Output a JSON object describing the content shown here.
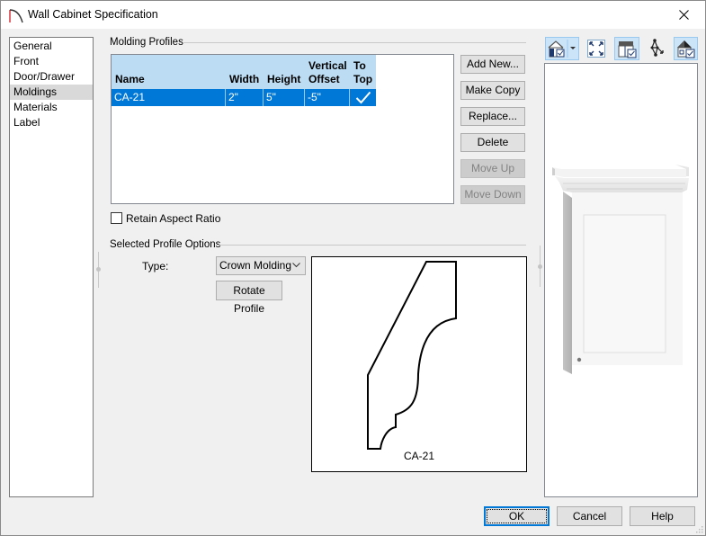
{
  "window": {
    "title": "Wall Cabinet Specification",
    "close_icon": "close-icon"
  },
  "nav": {
    "items": [
      {
        "label": "General",
        "selected": false
      },
      {
        "label": "Front",
        "selected": false
      },
      {
        "label": "Door/Drawer",
        "selected": false
      },
      {
        "label": "Moldings",
        "selected": true
      },
      {
        "label": "Materials",
        "selected": false
      },
      {
        "label": "Label",
        "selected": false
      }
    ]
  },
  "molding_profiles": {
    "group_label": "Molding Profiles",
    "columns": {
      "name": "Name",
      "width": "Width",
      "height": "Height",
      "vertical_offset_line1": "Vertical",
      "vertical_offset_line2": "Offset",
      "to_top_line1": "To",
      "to_top_line2": "Top"
    },
    "rows": [
      {
        "name": "CA-21",
        "width": "2\"",
        "height": "5\"",
        "vertical_offset": "-5\"",
        "to_top": true
      }
    ],
    "selected_row": 0
  },
  "buttons": {
    "add_new": "Add New...",
    "make_copy": "Make Copy",
    "replace": "Replace...",
    "delete": "Delete",
    "move_up": "Move Up",
    "move_down": "Move Down"
  },
  "retain_aspect_ratio": {
    "label": "Retain Aspect Ratio",
    "checked": false
  },
  "selected_profile_options": {
    "group_label": "Selected Profile Options",
    "type_label": "Type:",
    "type_value": "Crown Molding",
    "rotate_button": "Rotate Profile",
    "preview_label": "CA-21"
  },
  "view_toolbar": {
    "tools": [
      {
        "icon": "camera-view-icon",
        "active": true,
        "has_dropdown": true
      },
      {
        "icon": "fill-window-icon",
        "active": false
      },
      {
        "icon": "show-room-icon",
        "active": true
      },
      {
        "icon": "dimension-lines-icon",
        "active": false
      },
      {
        "icon": "show-shading-icon",
        "active": true
      }
    ]
  },
  "footer": {
    "ok": "OK",
    "cancel": "Cancel",
    "help": "Help"
  },
  "colors": {
    "selection_blue": "#0078d7",
    "header_blue": "#bcdcf3",
    "dialog_bg": "#f0f0f0"
  }
}
